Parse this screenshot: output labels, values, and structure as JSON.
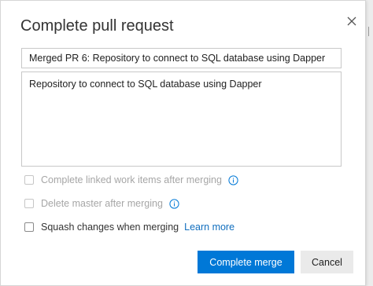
{
  "dialog": {
    "title": "Complete pull request",
    "close_icon": "close-icon"
  },
  "form": {
    "title_value": "Merged PR 6: Repository to connect to SQL database using Dapper",
    "description_value": "Repository to connect to SQL database using Dapper"
  },
  "options": {
    "complete_work_items": {
      "label": "Complete linked work items after merging",
      "checked": false,
      "disabled": true,
      "icon": "info-icon"
    },
    "delete_branch": {
      "label": "Delete master after merging",
      "checked": false,
      "disabled": true,
      "icon": "info-icon"
    },
    "squash": {
      "label": "Squash changes when merging",
      "checked": false,
      "disabled": false,
      "link": "Learn more"
    }
  },
  "buttons": {
    "complete_label": "Complete merge",
    "cancel_label": "Cancel"
  },
  "colors": {
    "primary": "#0078d7",
    "link": "#106ebe",
    "disabled_text": "#a6a6a6",
    "info_icon": "#0078d7"
  }
}
